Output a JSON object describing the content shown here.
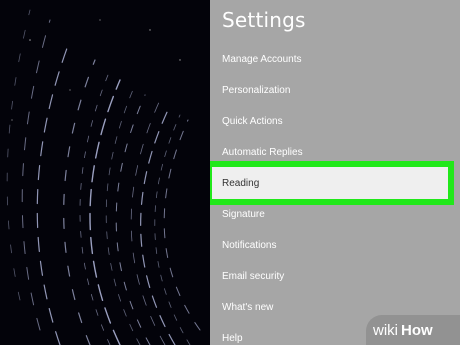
{
  "settings": {
    "title": "Settings",
    "items": [
      {
        "label": "Manage Accounts"
      },
      {
        "label": "Personalization"
      },
      {
        "label": "Quick Actions"
      },
      {
        "label": "Automatic Replies"
      },
      {
        "label": "Reading",
        "selected": true
      },
      {
        "label": "Signature"
      },
      {
        "label": "Notifications"
      },
      {
        "label": "Email security"
      },
      {
        "label": "What's new"
      },
      {
        "label": "Help"
      }
    ]
  },
  "colors": {
    "panel_bg": "#a6a6a6",
    "highlight_border": "#21e81a",
    "selected_bg": "#efefef"
  },
  "watermark": {
    "text": "wikiHow"
  }
}
